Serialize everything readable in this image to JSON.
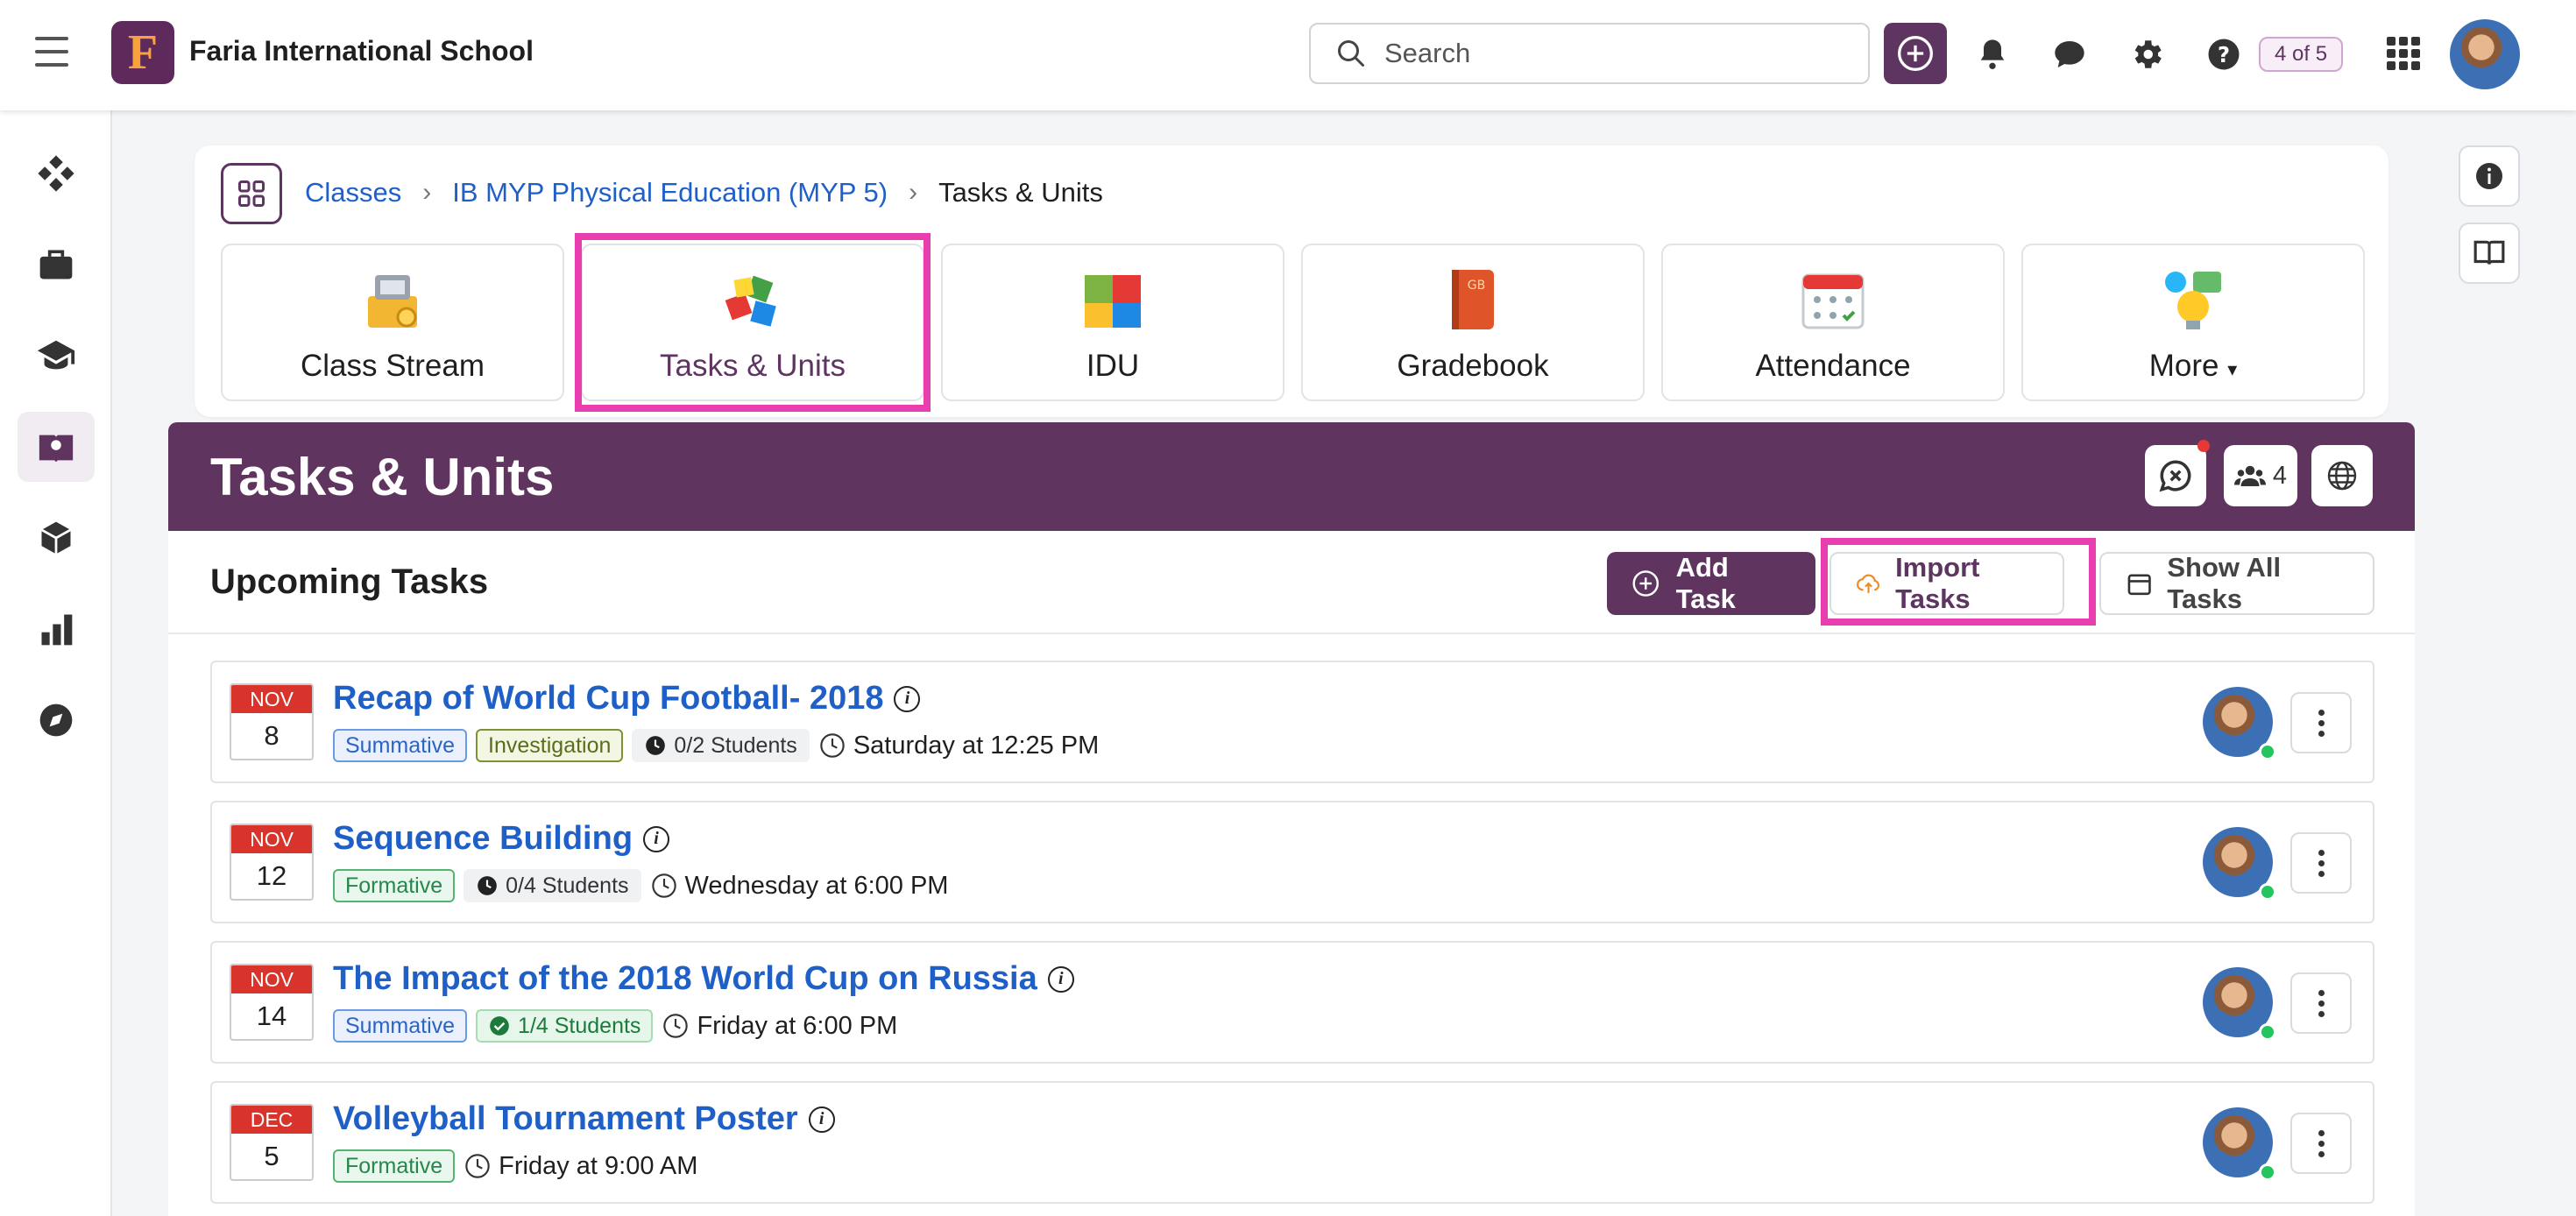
{
  "header": {
    "school_name": "Faria International School",
    "logo_letter": "F",
    "search_placeholder": "Search",
    "badge": "4 of 5"
  },
  "icons": {
    "menu": "hamburger-icon",
    "plus": "plus-circle-icon",
    "bell": "bell-icon",
    "chat": "chat-icon",
    "settings": "gear-icon",
    "help": "question-icon",
    "apps": "apps-grid-icon"
  },
  "breadcrumb": {
    "items": [
      "Classes",
      "IB MYP Physical Education (MYP 5)"
    ],
    "current": "Tasks & Units"
  },
  "class_tabs": [
    {
      "label": "Class Stream",
      "icon": "class-stream-icon"
    },
    {
      "label": "Tasks & Units",
      "icon": "puzzle-icon"
    },
    {
      "label": "IDU",
      "icon": "idu-puzzle-icon"
    },
    {
      "label": "Gradebook",
      "icon": "gradebook-icon"
    },
    {
      "label": "Attendance",
      "icon": "attendance-calendar-icon"
    },
    {
      "label": "More",
      "icon": "more-ideas-icon"
    }
  ],
  "page": {
    "title": "Tasks & Units",
    "members_count": "4"
  },
  "upcoming": {
    "title": "Upcoming Tasks",
    "add_task": "Add Task",
    "import_tasks": "Import Tasks",
    "show_all": "Show All Tasks"
  },
  "tasks": [
    {
      "month": "NOV",
      "day": "8",
      "title": "Recap of World Cup Football- 2018",
      "tags": [
        "Summative",
        "Investigation"
      ],
      "students": "0/2 Students",
      "due": "Saturday at 12:25 PM"
    },
    {
      "month": "NOV",
      "day": "12",
      "title": "Sequence Building",
      "tags": [
        "Formative"
      ],
      "students": "0/4 Students",
      "due": "Wednesday at 6:00 PM"
    },
    {
      "month": "NOV",
      "day": "14",
      "title": "The Impact of the 2018 World Cup on Russia",
      "tags": [
        "Summative"
      ],
      "students": "1/4 Students",
      "due": "Friday at 6:00 PM"
    },
    {
      "month": "DEC",
      "day": "5",
      "title": "Volleyball Tournament Poster",
      "tags": [
        "Formative"
      ],
      "students": "",
      "due": "Friday at 9:00 AM"
    }
  ],
  "colors": {
    "brand_purple": "#5f355f",
    "highlight_pink": "#e83eb0",
    "link_blue": "#1f5fc8",
    "calendar_red": "#d8342c"
  }
}
